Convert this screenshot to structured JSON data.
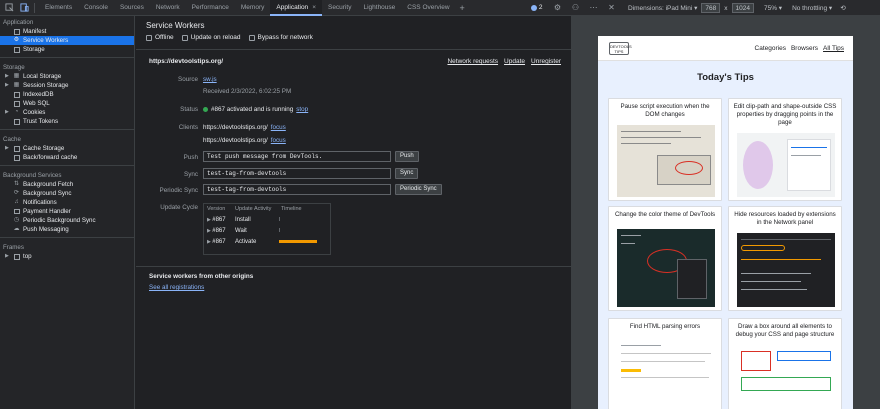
{
  "toolbar": {
    "tabs": [
      {
        "label": "Elements"
      },
      {
        "label": "Console"
      },
      {
        "label": "Sources"
      },
      {
        "label": "Network"
      },
      {
        "label": "Performance"
      },
      {
        "label": "Memory"
      },
      {
        "label": "Application",
        "active": true
      },
      {
        "label": "Security"
      },
      {
        "label": "Lighthouse"
      },
      {
        "label": "CSS Overview"
      }
    ],
    "issues_count": "2",
    "close_tab_glyph": "×",
    "add_tab_glyph": "+"
  },
  "device_bar": {
    "dimensions_label": "Dimensions: iPad Mini",
    "width": "768",
    "times": "x",
    "height": "1024",
    "zoom": "75%",
    "throttle": "No throttling"
  },
  "sidebar": {
    "sections": [
      {
        "title": "Application",
        "items": [
          {
            "label": "Manifest",
            "icon": "file-icon"
          },
          {
            "label": "Service Workers",
            "icon": "gear-icon",
            "selected": true
          },
          {
            "label": "Storage",
            "icon": "file-icon"
          }
        ]
      },
      {
        "title": "Storage",
        "items": [
          {
            "label": "Local Storage",
            "icon": "grid-icon",
            "expandable": true
          },
          {
            "label": "Session Storage",
            "icon": "grid-icon",
            "expandable": true
          },
          {
            "label": "IndexedDB",
            "icon": "database-icon"
          },
          {
            "label": "Web SQL",
            "icon": "database-icon"
          },
          {
            "label": "Cookies",
            "icon": "cookie-icon",
            "expandable": true
          },
          {
            "label": "Trust Tokens",
            "icon": "database-icon"
          }
        ]
      },
      {
        "title": "Cache",
        "items": [
          {
            "label": "Cache Storage",
            "icon": "database-icon",
            "expandable": true
          },
          {
            "label": "Back/forward cache",
            "icon": "database-icon"
          }
        ]
      },
      {
        "title": "Background Services",
        "items": [
          {
            "label": "Background Fetch",
            "icon": "sync-icon"
          },
          {
            "label": "Background Sync",
            "icon": "sync-icon"
          },
          {
            "label": "Notifications",
            "icon": "bell-icon"
          },
          {
            "label": "Payment Handler",
            "icon": "card-icon"
          },
          {
            "label": "Periodic Background Sync",
            "icon": "clock-icon"
          },
          {
            "label": "Push Messaging",
            "icon": "cloud-icon"
          }
        ]
      },
      {
        "title": "Frames",
        "items": [
          {
            "label": "top",
            "icon": "frame-icon",
            "expandable": true
          }
        ]
      }
    ]
  },
  "main": {
    "title": "Service Workers",
    "options": [
      {
        "label": "Offline"
      },
      {
        "label": "Update on reload"
      },
      {
        "label": "Bypass for network"
      }
    ],
    "origin": "https://devtoolstips.org/",
    "origin_links": [
      "Network requests",
      "Update",
      "Unregister"
    ],
    "source_label": "Source",
    "source_value": "sw.js",
    "received": "Received 2/3/2022, 6:02:25 PM",
    "status_label": "Status",
    "status_value": "#867 activated and is running",
    "status_link": "stop",
    "clients_label": "Clients",
    "clients": [
      {
        "url": "https://devtoolstips.org/",
        "link": "focus"
      },
      {
        "url": "https://devtoolstips.org/",
        "link": "focus"
      }
    ],
    "push_label": "Push",
    "push_value": "Test push message from DevTools.",
    "push_button": "Push",
    "sync_label": "Sync",
    "sync_value": "test-tag-from-devtools",
    "sync_button": "Sync",
    "periodic_label": "Periodic Sync",
    "periodic_value": "test-tag-from-devtools",
    "periodic_button": "Periodic Sync",
    "update_cycle_label": "Update Cycle",
    "cycle_headers": [
      "Version",
      "Update Activity",
      "Timeline"
    ],
    "cycle_rows": [
      {
        "version": "#867",
        "activity": "Install"
      },
      {
        "version": "#867",
        "activity": "Wait"
      },
      {
        "version": "#867",
        "activity": "Activate"
      }
    ],
    "other_origins_title": "Service workers from other origins",
    "see_all_link": "See all registrations"
  },
  "preview": {
    "logo_text": "DEVTOOLS TIPS",
    "nav": [
      "Categories",
      "Browsers",
      "All Tips"
    ],
    "heading": "Today's Tips",
    "cards": [
      {
        "title": "Pause script execution when the DOM changes"
      },
      {
        "title": "Edit clip-path and shape-outside CSS properties by dragging points in the page"
      },
      {
        "title": "Change the color theme of DevTools"
      },
      {
        "title": "Hide resources loaded by extensions in the Network panel"
      },
      {
        "title": "Find HTML parsing errors"
      },
      {
        "title": "Draw a box around all elements to debug your CSS and page structure"
      }
    ]
  }
}
